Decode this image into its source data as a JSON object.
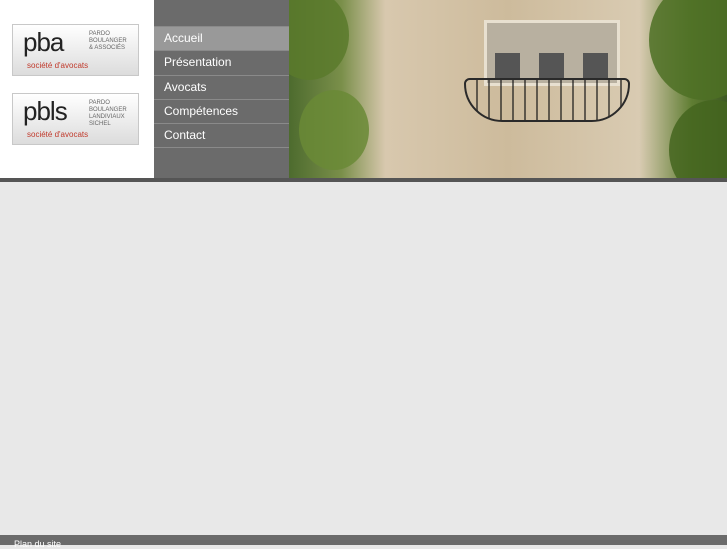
{
  "logos": [
    {
      "mark": "pba",
      "names": [
        "PARDO",
        "BOULANGER",
        "& ASSOCIÉS"
      ],
      "subtitle": "société d'avocats"
    },
    {
      "mark": "pbls",
      "names": [
        "PARDO",
        "BOULANGER",
        "LANDIVIAUX",
        "SICHEL"
      ],
      "subtitle": "société d'avocats"
    }
  ],
  "nav": {
    "items": [
      {
        "label": "Accueil",
        "active": true
      },
      {
        "label": "Présentation",
        "active": false
      },
      {
        "label": "Avocats",
        "active": false
      },
      {
        "label": "Compétences",
        "active": false
      },
      {
        "label": "Contact",
        "active": false
      }
    ]
  },
  "footer": {
    "sitemap_label": "Plan du site"
  },
  "colors": {
    "nav_bg": "#6b6b6b",
    "nav_active": "#999999",
    "content_bg": "#e8e8e8",
    "logo_accent": "#c0392b"
  }
}
